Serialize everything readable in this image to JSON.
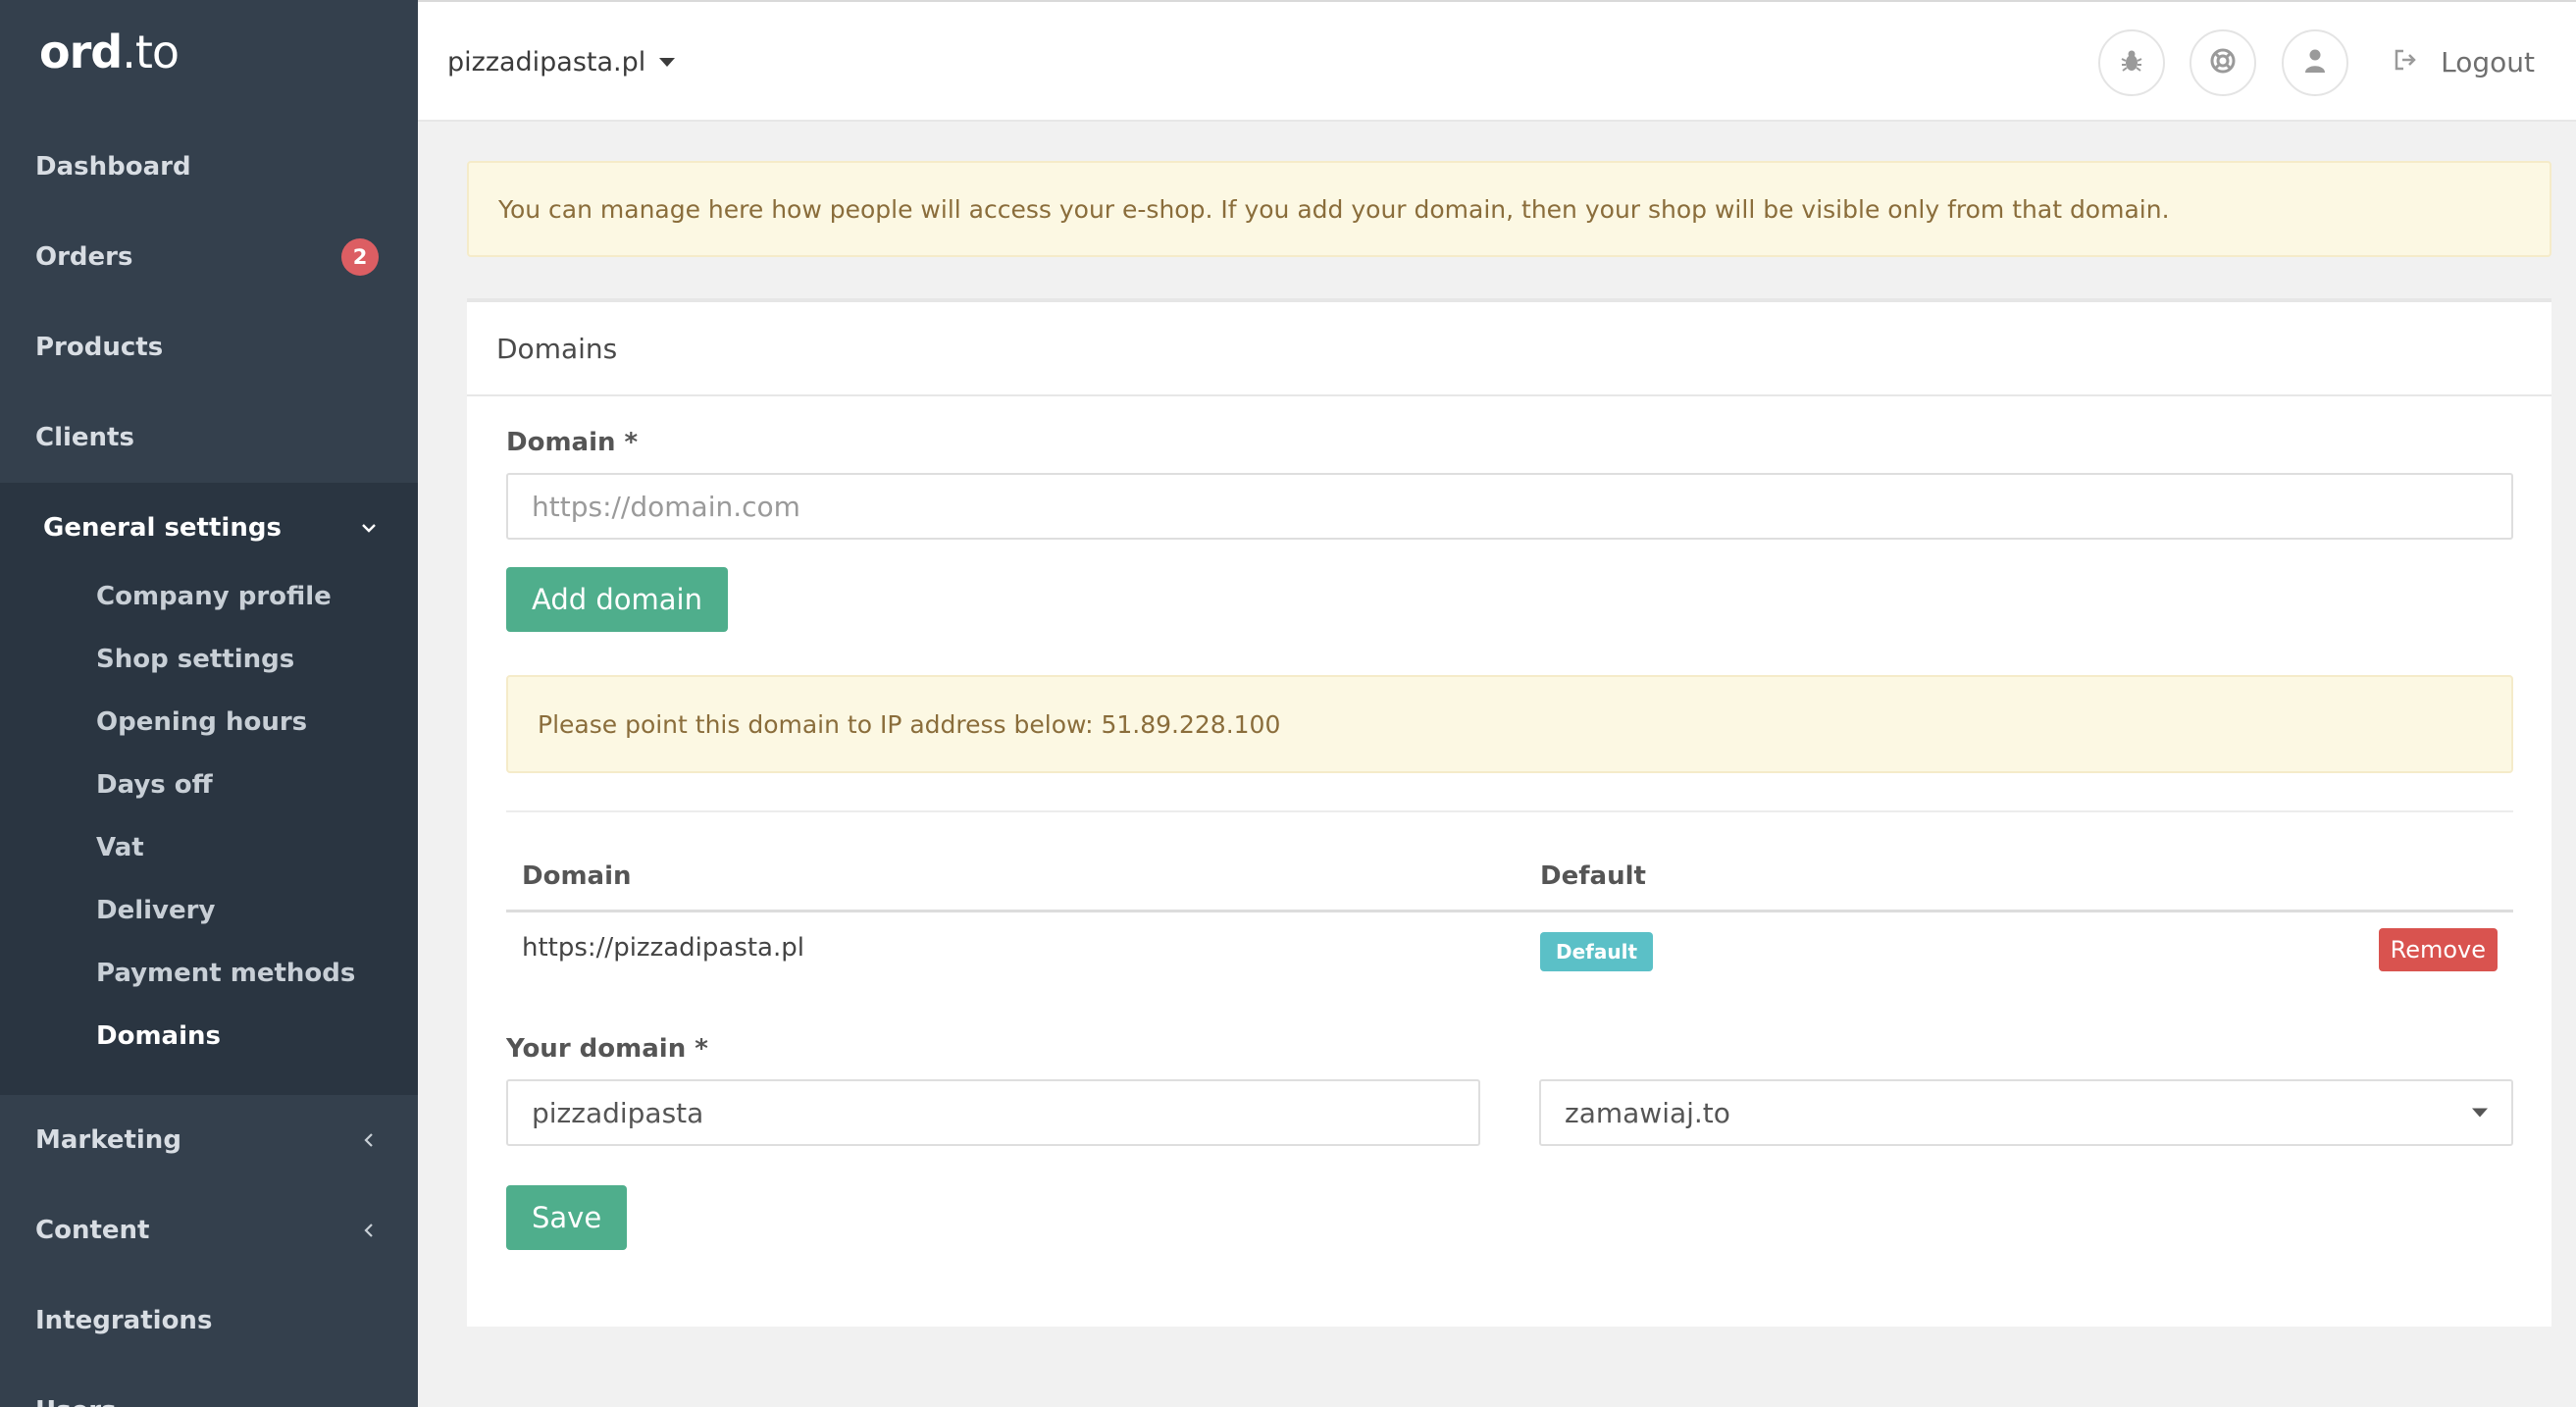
{
  "app": {
    "logo_strong": "ord",
    "logo_light": ".to"
  },
  "sidebar": {
    "items": [
      {
        "label": "Dashboard"
      },
      {
        "label": "Orders",
        "badge": "2"
      },
      {
        "label": "Products"
      },
      {
        "label": "Clients"
      }
    ],
    "group": {
      "label": "General settings",
      "subitems": [
        {
          "label": "Company profile"
        },
        {
          "label": "Shop settings"
        },
        {
          "label": "Opening hours"
        },
        {
          "label": "Days off"
        },
        {
          "label": "Vat"
        },
        {
          "label": "Delivery"
        },
        {
          "label": "Payment methods"
        },
        {
          "label": "Domains",
          "active": true
        }
      ]
    },
    "items_after": [
      {
        "label": "Marketing"
      },
      {
        "label": "Content"
      },
      {
        "label": "Integrations"
      },
      {
        "label": "Users"
      }
    ]
  },
  "header": {
    "shop_name": "pizzadipasta.pl",
    "icons": [
      "bug-icon",
      "lifebuoy-icon",
      "user-icon"
    ],
    "logout_label": "Logout"
  },
  "alert": {
    "text": "You can manage here how people will access your e-shop. If you add your domain, then your shop will be visible only from that domain."
  },
  "panel": {
    "title": "Domains",
    "domain_label": "Domain *",
    "domain_placeholder": "https://domain.com",
    "add_button": "Add domain",
    "ip_notice": "Please point this domain to IP address below: 51.89.228.100",
    "table": {
      "headers": [
        "Domain",
        "Default"
      ],
      "rows": [
        {
          "domain": "https://pizzadipasta.pl",
          "default_badge": "Default",
          "remove_label": "Remove"
        }
      ]
    },
    "your_domain_label": "Your domain *",
    "your_domain_value": "pizzadipasta",
    "suffix_value": "zamawiaj.to",
    "save_button": "Save"
  },
  "colors": {
    "sidebar_bg": "#34404d",
    "sidebar_group_bg": "#2a3541",
    "accent_green": "#4fae8c",
    "badge_red": "#dc5e63",
    "default_label": "#5bc0c7",
    "remove_red": "#d9534f",
    "alert_bg": "#fcf8e3",
    "alert_text": "#8a6d3b"
  }
}
